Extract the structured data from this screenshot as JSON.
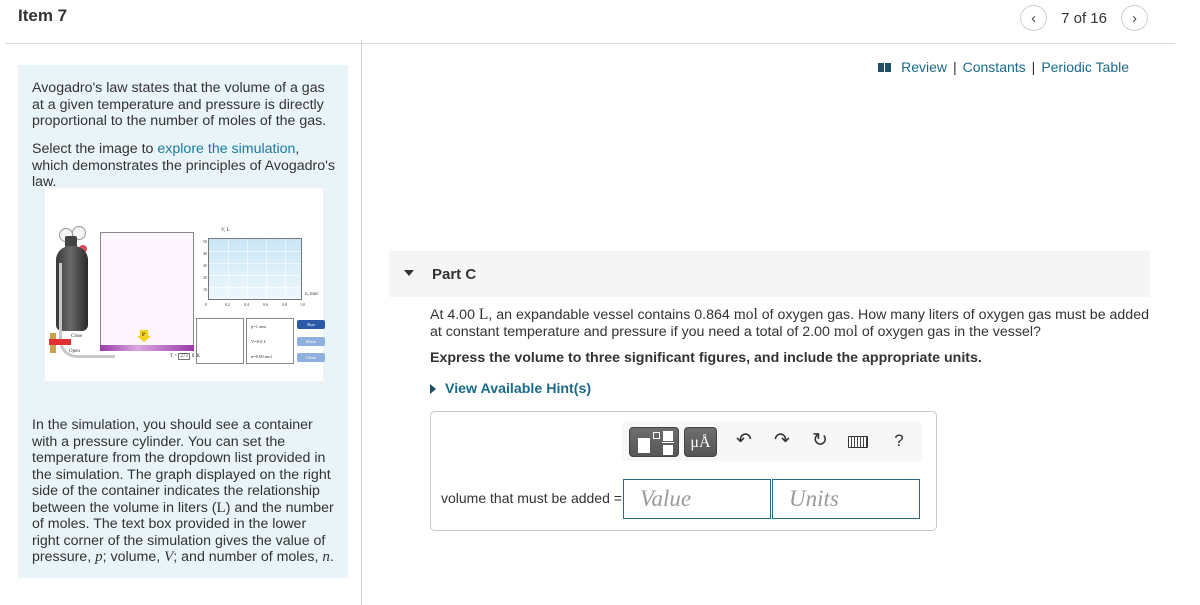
{
  "header": {
    "item_title": "Item 7",
    "pager": {
      "text": "7 of 16",
      "prev_glyph": "‹",
      "next_glyph": "›"
    }
  },
  "resources": {
    "icon": "book-icon",
    "links": [
      "Review",
      "Constants",
      "Periodic Table"
    ],
    "separator": "|"
  },
  "intro": {
    "p1": "Avogadro's law states that the volume of a gas at a given temperature and pressure is directly proportional to the number of moles of the gas.",
    "p2_before": "Select the image to ",
    "p2_link": "explore the simulation",
    "p2_after": ", which demonstrates the principles of Avogadro's law.",
    "p3_segments": {
      "a": "In the simulation, you should see a container with a pressure cylinder. You can set the temperature from the dropdown list provided in the simulation. The graph displayed on the right side of the container indicates the relationship between the volume in liters (",
      "unit_L": "L",
      "b": ") and the number of moles. The text box provided in the lower right corner of the simulation gives the value of pressure, ",
      "p": "p",
      "c": "; volume, ",
      "V": "V",
      "d": "; and number of moles, ",
      "n": "n",
      "e": "."
    }
  },
  "simulation": {
    "y_axis_label": "V, L",
    "x_axis_label": "n, mol",
    "y_ticks": [
      "10",
      "20",
      "30",
      "40",
      "50"
    ],
    "x_ticks": [
      "0",
      "0.2",
      "0.4",
      "0.6",
      "0.8",
      "1.0"
    ],
    "pressure_readout": "p=1 atm",
    "volume_readout": "V=0.0  L",
    "moles_readout": "n=0.00 mol",
    "temperature_label": "T =",
    "temperature_value": "273",
    "temperature_unit": "K",
    "close_label": "Close",
    "open_label": "Open",
    "piston_label": "P",
    "buttons": {
      "run": "Run",
      "reset": "Reset",
      "clear": "Clear"
    },
    "colors": {
      "run": "#2a5aa8",
      "disabled": "#8fb0dc"
    }
  },
  "part": {
    "title": "Part C",
    "question": {
      "a": "At 4.00 ",
      "unit1": "L",
      "b": ", an expandable vessel contains 0.864 ",
      "unit2": "mol",
      "c": " of oxygen gas. How many liters of oxygen gas must be added at constant temperature and pressure if you need a total of 2.00 ",
      "unit3": "mol",
      "d": " of oxygen gas in the vessel?"
    },
    "instruction": "Express the volume to three significant figures, and include the appropriate units.",
    "hints_label": "View Available Hint(s)"
  },
  "answer": {
    "toolbar": {
      "templates_icon": "fraction-template-icon",
      "units_label": "μÅ",
      "undo_glyph": "↶",
      "redo_glyph": "↷",
      "reset_glyph": "↻",
      "keyboard_icon": "keyboard-icon",
      "help_glyph": "?"
    },
    "label": "volume that must be added =",
    "value_placeholder": "Value",
    "units_placeholder": "Units",
    "value": "",
    "units": ""
  },
  "colors": {
    "link": "#1a6a8a",
    "intro_bg": "#e9f4f8",
    "part_bar_bg": "#f5f5f5",
    "input_border": "#2a6a80"
  }
}
